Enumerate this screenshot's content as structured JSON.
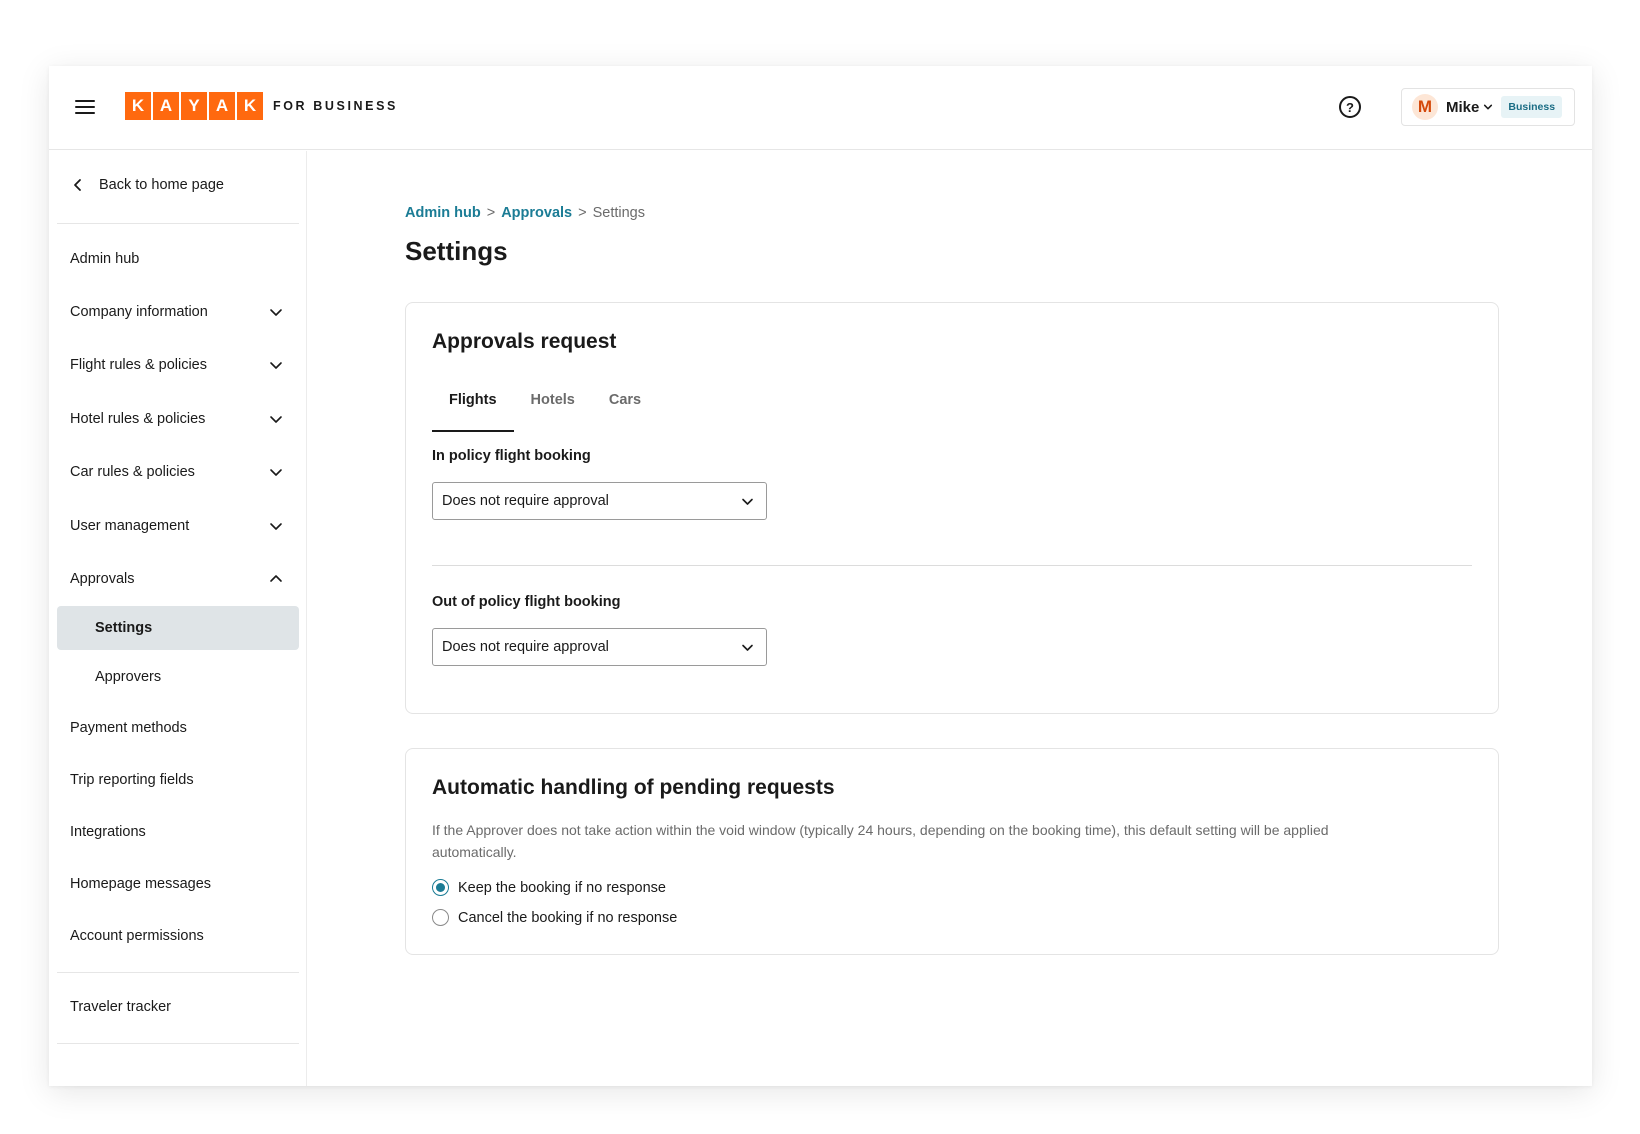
{
  "header": {
    "logo_letters": [
      "K",
      "A",
      "Y",
      "A",
      "K"
    ],
    "logo_suffix": "FOR BUSINESS",
    "help_glyph": "?",
    "user": {
      "initial": "M",
      "name": "Mike",
      "badge": "Business"
    },
    "colors": {
      "brand": "#ff690f",
      "accent": "#1b7c95"
    }
  },
  "sidebar": {
    "back_label": "Back to home page",
    "items": [
      {
        "label": "Admin hub"
      },
      {
        "label": "Company information",
        "icon": "chevron-down-icon"
      },
      {
        "label": "Flight rules & policies",
        "icon": "chevron-down-icon"
      },
      {
        "label": "Hotel rules & policies",
        "icon": "chevron-down-icon"
      },
      {
        "label": "Car rules & policies",
        "icon": "chevron-down-icon"
      },
      {
        "label": "User management",
        "icon": "chevron-down-icon"
      },
      {
        "label": "Approvals",
        "icon": "chevron-up-icon"
      },
      {
        "label": "Settings",
        "active": true
      },
      {
        "label": "Approvers"
      },
      {
        "label": "Payment methods"
      },
      {
        "label": "Trip reporting fields"
      },
      {
        "label": "Integrations"
      },
      {
        "label": "Homepage messages"
      },
      {
        "label": "Account permissions"
      },
      {
        "label": "Traveler tracker"
      }
    ]
  },
  "main": {
    "breadcrumb": {
      "first": "Admin hub",
      "second": "Approvals",
      "current": "Settings",
      "separator": ">"
    },
    "title": "Settings",
    "approvals_card": {
      "title": "Approvals request",
      "tabs": [
        "Flights",
        "Hotels",
        "Cars"
      ],
      "active_tab": "Flights",
      "in_policy_label": "In policy flight booking",
      "in_policy_value": "Does not require approval",
      "out_policy_label": "Out of policy flight booking",
      "out_policy_value": "Does not require approval"
    },
    "auto_card": {
      "title": "Automatic handling of pending requests",
      "description": "If the Approver does not take action within the void window (typically 24 hours, depending on the booking time), this default setting will be applied automatically.",
      "options": [
        "Keep the booking if no response",
        "Cancel the booking if no response"
      ],
      "selected": "Keep the booking if no response"
    }
  }
}
